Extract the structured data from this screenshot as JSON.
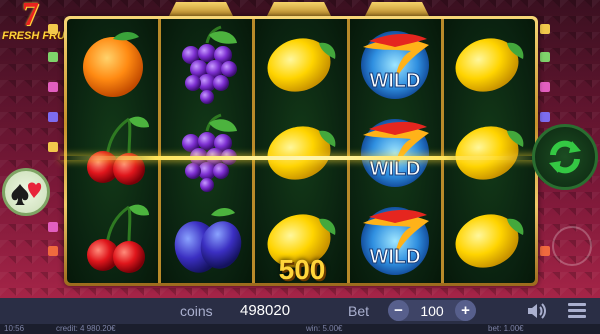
{
  "logo": {
    "seven": "7",
    "brand": "FRESH FRUITS"
  },
  "reels": [
    [
      "orange",
      "cherry",
      "cherry"
    ],
    [
      "grape",
      "grape",
      "plum"
    ],
    [
      "lemon",
      "lemon",
      "lemon"
    ],
    [
      "wild",
      "wild",
      "wild"
    ],
    [
      "lemon",
      "lemon",
      "lemon"
    ]
  ],
  "wild_text": "WILD",
  "win_amount": "500",
  "controls": {
    "coins_label": "coins",
    "coins_value": "498020",
    "bet_label": "Bet",
    "bet_value": "100",
    "minus": "−",
    "plus": "+"
  },
  "footer": {
    "time": "10:56",
    "credit": "credit: 4 980.20€",
    "win": "win: 5.00€",
    "bet": "bet: 1.00€"
  },
  "colors": {
    "accent_gold": "#ffd63a",
    "spin_green": "#34c843",
    "bar_bg": "#2a2e45"
  },
  "icons": {
    "gamble": "suit-heart-spade-icon",
    "spin": "refresh-arrows-icon",
    "sound": "speaker-icon",
    "menu": "hamburger-icon"
  }
}
